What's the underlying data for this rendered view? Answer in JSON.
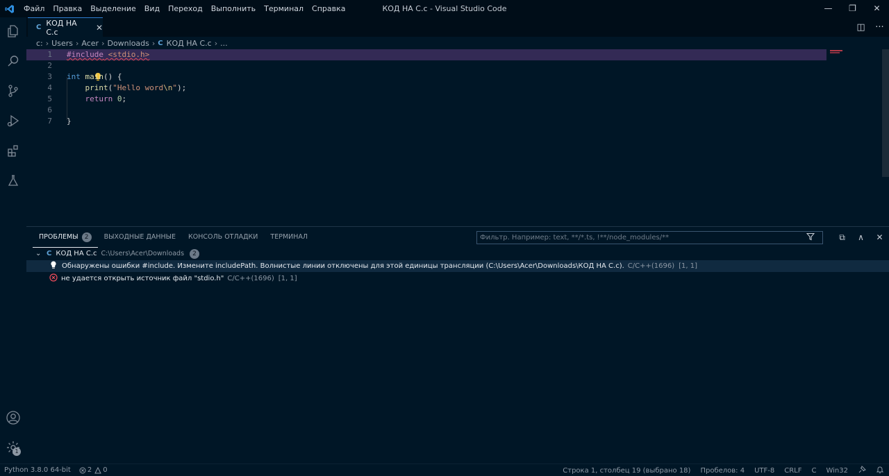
{
  "titlebar": {
    "menu": [
      "Файл",
      "Правка",
      "Выделение",
      "Вид",
      "Переход",
      "Выполнить",
      "Терминал",
      "Справка"
    ],
    "title": "КОД НА С.с - Visual Studio Code",
    "controls": {
      "minimize": "—",
      "restore": "❐",
      "close": "✕"
    }
  },
  "activity_bar": {
    "icons": [
      "explorer-icon",
      "search-icon",
      "source-control-icon",
      "run-debug-icon",
      "extensions-icon",
      "testing-icon",
      "account-icon",
      "settings-gear-icon"
    ],
    "settings_badge": "1"
  },
  "tabs": [
    {
      "icon": "C",
      "label": "КОД НА С.с",
      "close": "✕"
    }
  ],
  "tab_actions": {
    "split": "◫",
    "more": "···"
  },
  "breadcrumb": {
    "items": [
      "c:",
      "Users",
      "Acer",
      "Downloads"
    ],
    "file_icon": "C",
    "file": "КОД НА С.с",
    "more": "...",
    "separator": "›"
  },
  "editor": {
    "line_numbers": [
      "1",
      "2",
      "3",
      "4",
      "5",
      "6",
      "7"
    ],
    "lines": [
      {
        "directive": "#include",
        "space": " ",
        "header": "<stdio.h>"
      },
      {
        "text": ""
      },
      {
        "kw": "int",
        "fn": "main",
        "rest": "() {"
      },
      {
        "indent": "    ",
        "fn": "print",
        "open": "(",
        "str1": "\"Hello word",
        "esc": "\\n",
        "str2": "\"",
        "close": ");"
      },
      {
        "indent": "    ",
        "kw": "return",
        "num": "0",
        "end": ";"
      },
      {
        "text": ""
      },
      {
        "text": "}"
      }
    ]
  },
  "panel": {
    "tabs": [
      {
        "label": "ПРОБЛЕМЫ",
        "badge": "2"
      },
      {
        "label": "ВЫХОДНЫЕ ДАННЫЕ"
      },
      {
        "label": "КОНСОЛЬ ОТЛАДКИ"
      },
      {
        "label": "ТЕРМИНАЛ"
      }
    ],
    "filter_placeholder": "Фильтр. Например: text, **/*.ts, !**/node_modules/**",
    "actions": {
      "collapse": "⧉",
      "maximize": "∧",
      "close": "✕"
    },
    "group": {
      "chevron": "⌄",
      "icon": "C",
      "file": "КОД НА С.с",
      "path": "C:\\Users\\Acer\\Downloads",
      "count": "2"
    },
    "problems": [
      {
        "kind": "lightbulb-icon",
        "message": "Обнаружены ошибки #include. Измените includePath. Волнистые линии отключены для этой единицы трансляции (C:\\Users\\Acer\\Downloads\\КОД НА С.с).",
        "source": "C/C++(1696)",
        "pos": "[1, 1]"
      },
      {
        "kind": "error-icon",
        "message": "не удается открыть источник файл \"stdio.h\"",
        "source": "C/C++(1696)",
        "pos": "[1, 1]"
      }
    ]
  },
  "status_bar": {
    "python": "Python 3.8.0 64-bit",
    "errors": "2",
    "warnings": "0",
    "cursor": "Строка 1, столбец 19 (выбрано 18)",
    "spaces": "Пробелов: 4",
    "encoding": "UTF-8",
    "eol": "CRLF",
    "language": "C",
    "platform": "Win32"
  },
  "colors": {
    "background": "#001626",
    "titlebar": "#000d18",
    "selection": "#332a55",
    "accent": "#2f7dd1",
    "error": "#e04a5a"
  }
}
